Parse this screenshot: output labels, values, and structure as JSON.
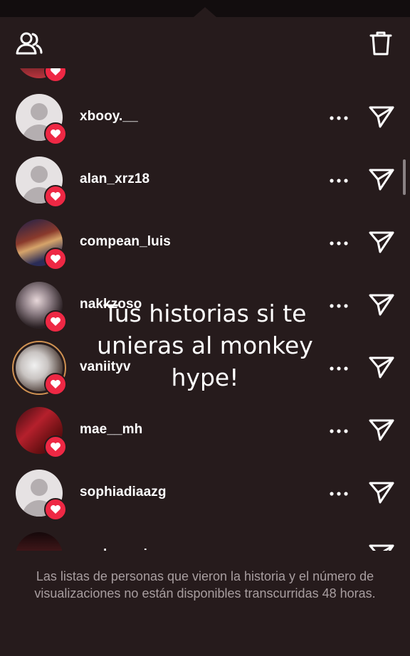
{
  "header": {
    "viewers_icon": "viewers-icon",
    "delete_icon": "trash-icon"
  },
  "viewers": [
    {
      "username": "",
      "avatar": "photo-5",
      "badge": "heart-icon"
    },
    {
      "username": "xbooy.__",
      "avatar": "placeholder",
      "badge": "heart-icon"
    },
    {
      "username": "alan_xrz18",
      "avatar": "placeholder",
      "badge": "heart-icon"
    },
    {
      "username": "compean_luis",
      "avatar": "photo-1",
      "badge": "heart-icon"
    },
    {
      "username": "nakkzoso",
      "avatar": "photo-2",
      "badge": "heart-icon"
    },
    {
      "username": "vaniityv",
      "avatar": "photo-3",
      "badge": "heart-icon",
      "story_ring": true
    },
    {
      "username": "mae__mh",
      "avatar": "photo-4",
      "badge": "heart-icon"
    },
    {
      "username": "sophiadiaazg",
      "avatar": "placeholder",
      "badge": "heart-icon"
    },
    {
      "username": "xgalpz_priv",
      "avatar": "photo-5",
      "badge": "heart-icon"
    }
  ],
  "overlay_caption": "Tus historias si te unieras al monkey hype!",
  "footer_note": "Las listas de personas que vieron la historia y el número de visualizaciones no están disponibles transcurridas 48 horas.",
  "colors": {
    "background": "#261b1c",
    "heart": "#ee2844",
    "footer_text": "#a89ea0"
  }
}
